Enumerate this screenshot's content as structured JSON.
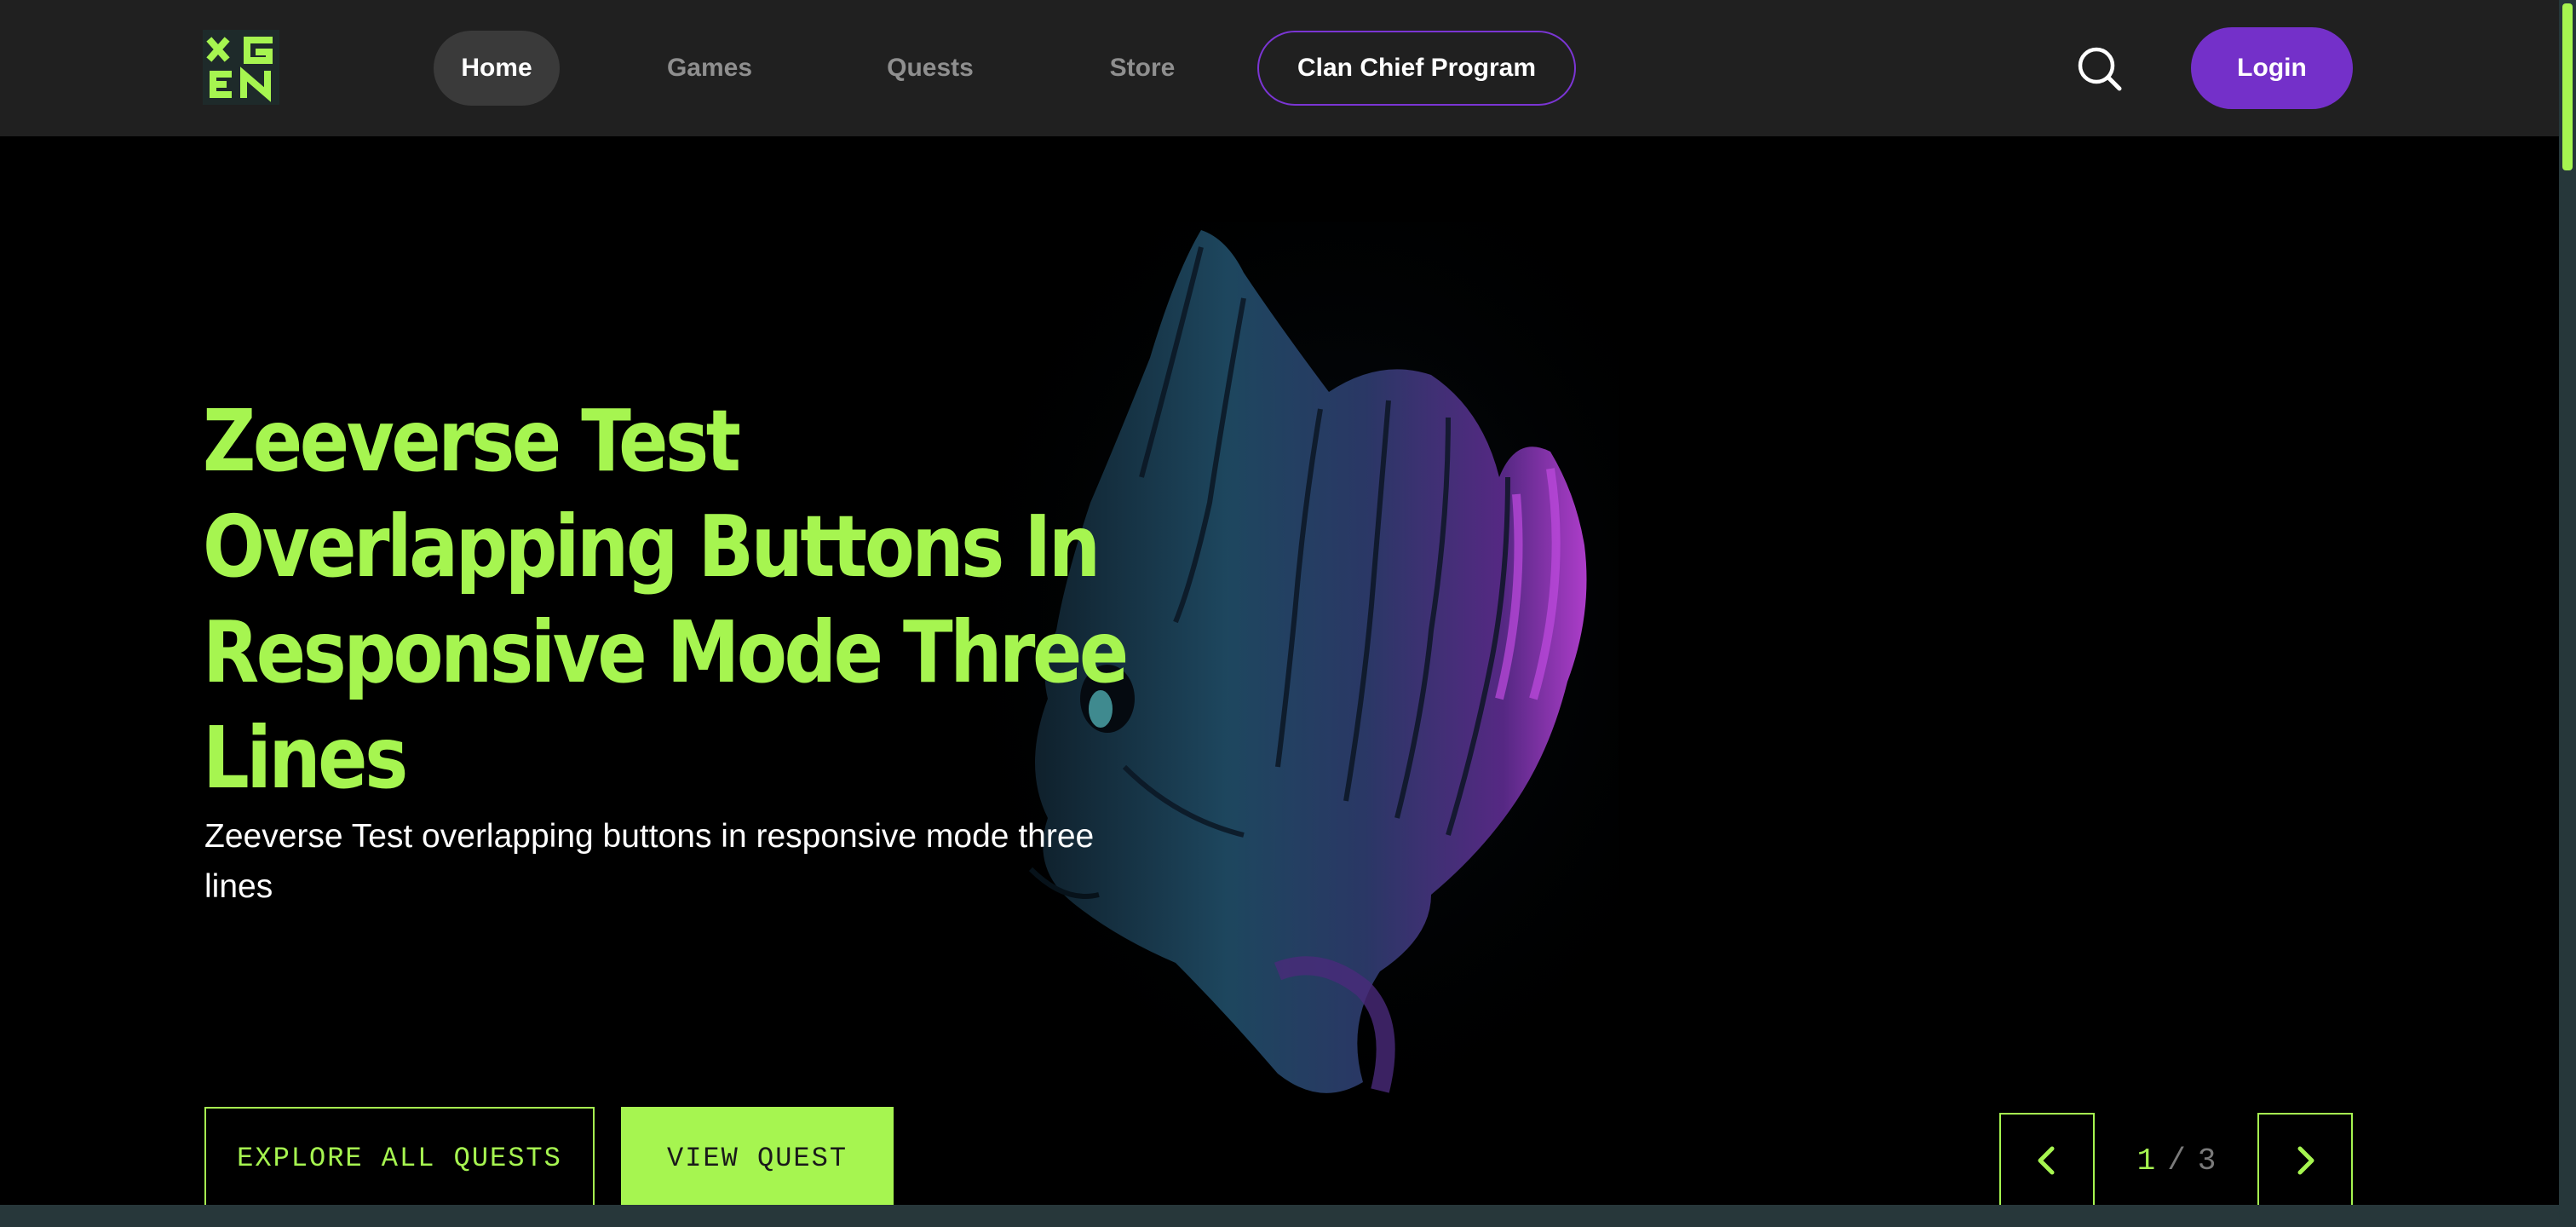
{
  "header": {
    "logo_label": "XGEN",
    "nav": [
      {
        "label": "Home"
      },
      {
        "label": "Games"
      },
      {
        "label": "Quests"
      },
      {
        "label": "Store"
      },
      {
        "label": "Clan Chief Program"
      }
    ],
    "active_nav": "Home",
    "login_label": "Login",
    "search_icon": "search-icon"
  },
  "hero": {
    "title": "Zeeverse Test Overlapping Buttons In Responsive Mode Three Lines",
    "description": "Zeeverse Test overlapping buttons in responsive mode three lines",
    "primary_button": "EXPLORE ALL QUESTS",
    "secondary_button": "VIEW QUEST",
    "pager": {
      "current": "1",
      "separator": "/",
      "total": "3"
    },
    "art": "groot-character-artwork"
  },
  "colors": {
    "accent_green": "#a6f550",
    "brand_purple": "#7430c9",
    "header_bg": "#202020",
    "hero_bg": "#000000"
  }
}
